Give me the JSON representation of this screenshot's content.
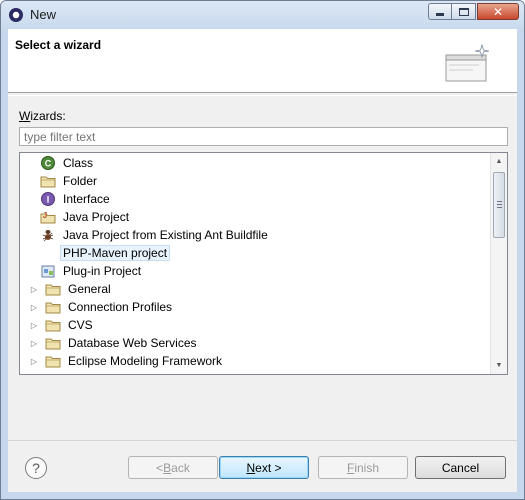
{
  "window": {
    "title": "New"
  },
  "banner": {
    "title": "Select a wizard"
  },
  "wizards_label": {
    "mnemonic": "W",
    "rest": "izards:"
  },
  "filter": {
    "placeholder": "type filter text",
    "value": ""
  },
  "tree": {
    "items": [
      {
        "label": "Class",
        "icon": "class-icon",
        "kind": "leaf"
      },
      {
        "label": "Folder",
        "icon": "folder-icon",
        "kind": "leaf"
      },
      {
        "label": "Interface",
        "icon": "interface-icon",
        "kind": "leaf"
      },
      {
        "label": "Java Project",
        "icon": "java-project-icon",
        "kind": "leaf"
      },
      {
        "label": "Java Project from Existing Ant Buildfile",
        "icon": "ant-icon",
        "kind": "leaf"
      },
      {
        "label": "PHP-Maven project",
        "icon": "",
        "kind": "leaf",
        "selected": true
      },
      {
        "label": "Plug-in Project",
        "icon": "plugin-project-icon",
        "kind": "leaf"
      },
      {
        "label": "General",
        "icon": "folder-icon",
        "kind": "group"
      },
      {
        "label": "Connection Profiles",
        "icon": "folder-icon",
        "kind": "group"
      },
      {
        "label": "CVS",
        "icon": "folder-icon",
        "kind": "group"
      },
      {
        "label": "Database Web Services",
        "icon": "folder-icon",
        "kind": "group"
      },
      {
        "label": "Eclipse Modeling Framework",
        "icon": "folder-icon",
        "kind": "group"
      }
    ]
  },
  "buttons": {
    "back": {
      "mnemonic": "< ",
      "key": "B",
      "rest": "ack",
      "enabled": false
    },
    "next": {
      "key": "N",
      "rest": "ext >",
      "enabled": true
    },
    "finish": {
      "key": "F",
      "rest": "inish",
      "enabled": false
    },
    "cancel": {
      "label": "Cancel",
      "enabled": true
    }
  },
  "help": {
    "glyph": "?"
  }
}
